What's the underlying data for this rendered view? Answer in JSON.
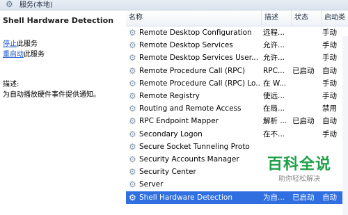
{
  "window": {
    "title": "服务(本地)"
  },
  "left_panel": {
    "service_name": "Shell Hardware Detection",
    "stop_link_text": "停止",
    "stop_suffix": "此服务",
    "restart_link_text": "重启动",
    "restart_suffix": "此服务",
    "desc_label": "描述:",
    "desc_text": "为自动播放硬件事件提供通知。"
  },
  "table": {
    "headers": {
      "name": "名称",
      "desc": "描述",
      "status": "状态",
      "start": "启动类"
    },
    "rows": [
      {
        "name": "Remote Desktop Configuration",
        "desc": "远程...",
        "status": "",
        "start": "手动"
      },
      {
        "name": "Remote Desktop Services",
        "desc": "允许...",
        "status": "",
        "start": "手动"
      },
      {
        "name": "Remote Desktop Services User...",
        "desc": "允许...",
        "status": "",
        "start": "手动"
      },
      {
        "name": "Remote Procedure Call (RPC)",
        "desc": "RPC...",
        "status": "已启动",
        "start": "自动"
      },
      {
        "name": "Remote Procedure Call (RPC) Lo...",
        "desc": "在 W...",
        "status": "",
        "start": "手动"
      },
      {
        "name": "Remote Registry",
        "desc": "使远...",
        "status": "",
        "start": "手动"
      },
      {
        "name": "Routing and Remote Access",
        "desc": "在局...",
        "status": "",
        "start": "禁用"
      },
      {
        "name": "RPC Endpoint Mapper",
        "desc": "解析 ...",
        "status": "已启动",
        "start": "自动"
      },
      {
        "name": "Secondary Logon",
        "desc": "在不...",
        "status": "",
        "start": "手动"
      },
      {
        "name": "Secure Socket Tunneling Proto",
        "desc": "",
        "status": "",
        "start": ""
      },
      {
        "name": "Security Accounts Manager",
        "desc": "",
        "status": "",
        "start": ""
      },
      {
        "name": "Security Center",
        "desc": "",
        "status": "",
        "start": ""
      },
      {
        "name": "Server",
        "desc": "",
        "status": "",
        "start": ""
      },
      {
        "name": "Shell Hardware Detection",
        "desc": "为自...",
        "status": "已启动",
        "start": "自动"
      }
    ],
    "selected_index": 13
  },
  "watermark": {
    "main": "百科全说",
    "sub": "助你轻松解决"
  },
  "colors": {
    "selection": "#2f6fe0",
    "link": "#1a55c6",
    "watermark": "#1fa04a"
  },
  "icons": {
    "service_row": "gear-icon",
    "title_bar": "gear-icon"
  }
}
